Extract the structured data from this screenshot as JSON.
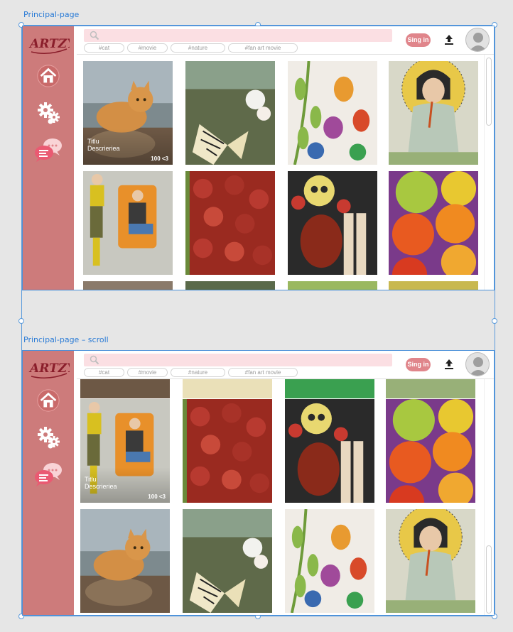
{
  "artboards": [
    {
      "label": "Principal-page"
    },
    {
      "label": "Principal-page – scroll"
    }
  ],
  "brand": {
    "logo_text": "ARTZY",
    "accent": "#cd7b7b",
    "pink": "#e0858b"
  },
  "search": {
    "placeholder": ""
  },
  "tags": [
    "#cat",
    "#movie",
    "#nature",
    "#fan art movie"
  ],
  "header": {
    "signin_label": "Sing in"
  },
  "nav": [
    {
      "name": "home-icon"
    },
    {
      "name": "settings-gears-icon"
    },
    {
      "name": "chat-icon"
    }
  ],
  "overlay": {
    "title": "Titlu",
    "description": "Descrieriea",
    "likes": "100 <3"
  },
  "tiles": [
    "cat",
    "butterfly",
    "beetles",
    "girl",
    "man-chair",
    "flowers",
    "skeleton",
    "citrus"
  ]
}
